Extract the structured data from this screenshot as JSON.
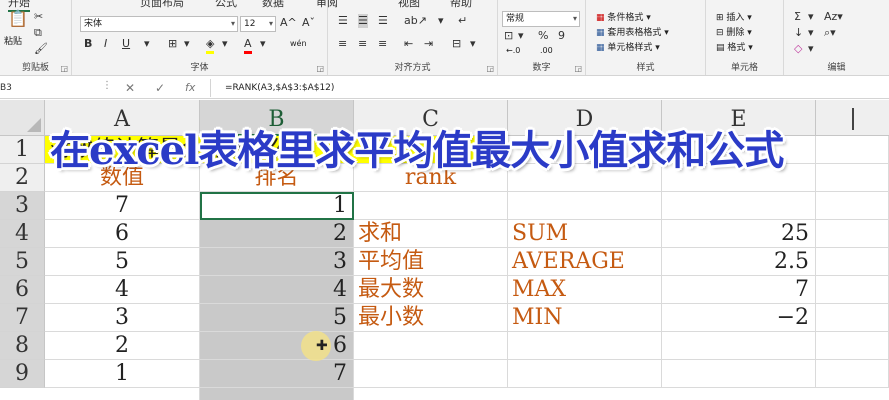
{
  "ribbon": {
    "tabs": [
      "开始",
      "页面布局",
      "公式",
      "数据",
      "审阅",
      "视图",
      "帮助"
    ],
    "clipboard": {
      "label": "剪贴板",
      "paste": "粘贴"
    },
    "font": {
      "label": "字体",
      "name": "宋体",
      "size": "12",
      "grow": "A^",
      "shrink": "Aˇ",
      "bold": "B",
      "italic": "I",
      "underline": "U",
      "wen": "wén"
    },
    "alignment": {
      "label": "对齐方式"
    },
    "number": {
      "label": "数字",
      "format": "常规",
      "percent": "%",
      "comma": "9",
      "inc": "←.0",
      "dec": ".00"
    },
    "styles": {
      "label": "样式",
      "conditional": "条件格式",
      "table": "套用表格格式",
      "cell": "单元格样式"
    },
    "cells": {
      "label": "单元格",
      "insert": "插入",
      "delete": "删除",
      "format": "格式"
    },
    "editing": {
      "label": "编辑",
      "sum": "Σ",
      "fill": "↓",
      "clear": "◇"
    },
    "colors": {
      "fill": "#ffff00",
      "font": "#ff0000"
    }
  },
  "formula_bar": {
    "name_box": "B3",
    "cancel": "✕",
    "confirm": "✓",
    "fx": "fx",
    "formula": "=RANK(A3,$A$3:$A$12)"
  },
  "sheet": {
    "columns": [
      "A",
      "B",
      "C",
      "D",
      "E"
    ],
    "rows": [
      "1",
      "2",
      "3",
      "4",
      "5",
      "6",
      "7",
      "8",
      "9"
    ],
    "title": "对数值计算最全的计算公式",
    "header_a": "数值",
    "header_b": "排名",
    "header_c": "rank",
    "col_a": [
      "7",
      "6",
      "5",
      "4",
      "3",
      "2",
      "1",
      ""
    ],
    "col_b": [
      "1",
      "2",
      "3",
      "4",
      "5",
      "6",
      "7",
      ""
    ],
    "c4": "求和",
    "d4": "SUM",
    "e4": "25",
    "c5": "平均值",
    "d5": "AVERAGE",
    "e5": "2.5",
    "c6": "最大数",
    "d6": "MAX",
    "e6": "7",
    "c7": "最小数",
    "d7": "MIN",
    "e7": "−2"
  },
  "overlay": {
    "text": "在excel表格里求平均值最大小值求和公式"
  },
  "cursor": {
    "symbol": "✚"
  }
}
